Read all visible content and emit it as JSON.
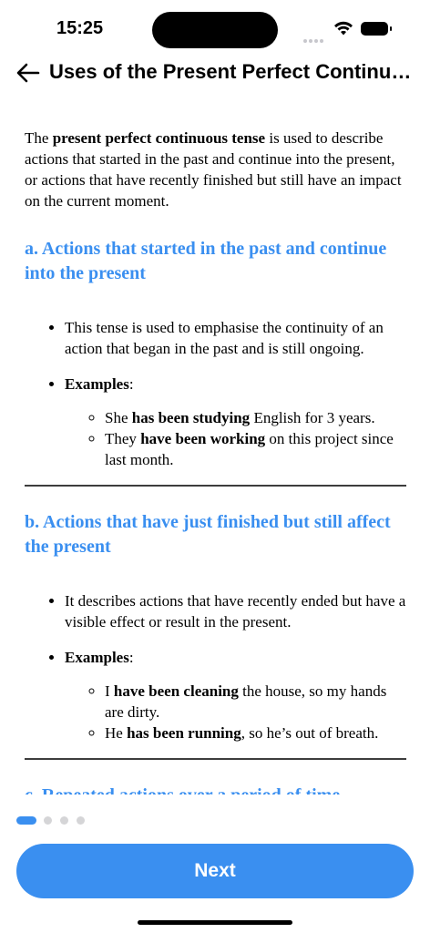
{
  "status_bar": {
    "time": "15:25"
  },
  "header": {
    "title": "Uses of the Present Perfect Continuo...",
    "back_icon": "arrow-left-icon"
  },
  "article": {
    "intro": {
      "before": "The ",
      "bold": "present perfect continuous tense",
      "after": " is used to describe actions that started in the past and continue into the present, or actions that have recently finished but still have an impact on the current moment."
    },
    "sections": [
      {
        "heading": "a. Actions that started in the past and continue into the present",
        "point": "This tense is used to emphasise the continuity of an action that began in the past and is still ongoing.",
        "examples_label": "Examples",
        "examples": [
          {
            "before": "She ",
            "bold": "has been studying",
            "after": " English for 3 years."
          },
          {
            "before": "They ",
            "bold": "have been working",
            "after": " on this project since last month."
          }
        ]
      },
      {
        "heading": "b. Actions that have just finished but still affect the present",
        "point": "It describes actions that have recently ended but have a visible effect or result in the present.",
        "examples_label": "Examples",
        "examples": [
          {
            "before": "I ",
            "bold": "have been cleaning",
            "after": " the house, so my hands are dirty."
          },
          {
            "before": "He ",
            "bold": "has been running",
            "after": ", so he’s out of breath."
          }
        ]
      },
      {
        "heading": "c. Repeated actions over a period of time"
      }
    ]
  },
  "pager": {
    "total": 4,
    "active_index": 0
  },
  "next_button": {
    "label": "Next"
  },
  "colors": {
    "accent": "#3a8ff0",
    "dot_inactive": "#d5d5d7",
    "divider": "#3d3d3d"
  }
}
